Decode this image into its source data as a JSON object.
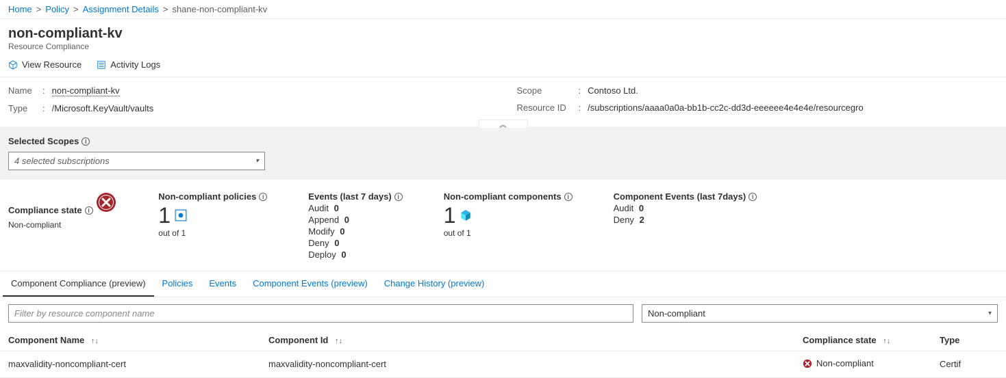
{
  "breadcrumb": {
    "home": "Home",
    "policy": "Policy",
    "assignment": "Assignment Details",
    "current": "shane-non-compliant-kv"
  },
  "header": {
    "title": "non-compliant-kv",
    "subtitle": "Resource Compliance"
  },
  "toolbar": {
    "view_resource": "View Resource",
    "activity_logs": "Activity Logs"
  },
  "props": {
    "name_label": "Name",
    "name_value": "non-compliant-kv",
    "type_label": "Type",
    "type_value": "/Microsoft.KeyVault/vaults",
    "scope_label": "Scope",
    "scope_value": "Contoso Ltd.",
    "resourceid_label": "Resource ID",
    "resourceid_value": "/subscriptions/aaaa0a0a-bb1b-cc2c-dd3d-eeeeee4e4e4e/resourcegro"
  },
  "scopes": {
    "label": "Selected Scopes",
    "selected": "4 selected subscriptions"
  },
  "stats": {
    "compliance_state": {
      "title": "Compliance state",
      "value": "Non-compliant"
    },
    "non_compliant_policies": {
      "title": "Non-compliant policies",
      "value": "1",
      "sub": "out of 1"
    },
    "events": {
      "title": "Events (last 7 days)",
      "audit_label": "Audit",
      "audit": "0",
      "append_label": "Append",
      "append": "0",
      "modify_label": "Modify",
      "modify": "0",
      "deny_label": "Deny",
      "deny": "0",
      "deploy_label": "Deploy",
      "deploy": "0"
    },
    "non_compliant_components": {
      "title": "Non-compliant components",
      "value": "1",
      "sub": "out of 1"
    },
    "component_events": {
      "title": "Component Events (last 7days)",
      "audit_label": "Audit",
      "audit": "0",
      "deny_label": "Deny",
      "deny": "2"
    }
  },
  "tabs": {
    "t0": "Component Compliance (preview)",
    "t1": "Policies",
    "t2": "Events",
    "t3": "Component Events (preview)",
    "t4": "Change History (preview)"
  },
  "filter": {
    "placeholder": "Filter by resource component name",
    "state_selected": "Non-compliant"
  },
  "table": {
    "col_name": "Component Name",
    "col_id": "Component Id",
    "col_state": "Compliance state",
    "col_type": "Type",
    "row0": {
      "name": "maxvalidity-noncompliant-cert",
      "id": "maxvalidity-noncompliant-cert",
      "state": "Non-compliant",
      "type": "Certif"
    }
  }
}
